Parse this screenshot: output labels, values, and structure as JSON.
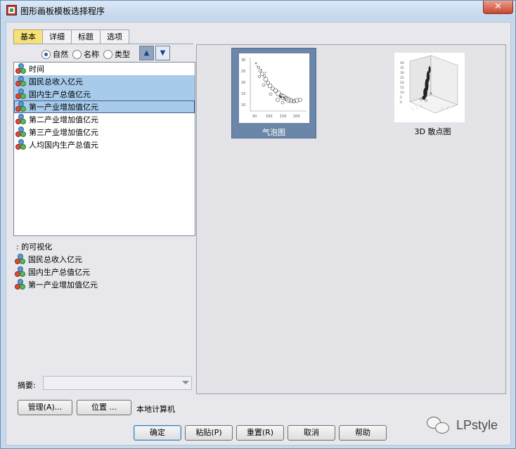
{
  "window": {
    "title": "图形画板模板选择程序",
    "close_label": "✕"
  },
  "tabs": [
    {
      "label": "基本",
      "active": true
    },
    {
      "label": "详细",
      "active": false
    },
    {
      "label": "标题",
      "active": false
    },
    {
      "label": "选项",
      "active": false
    }
  ],
  "sort": {
    "options": [
      {
        "label": "自然",
        "checked": true
      },
      {
        "label": "名称",
        "checked": false
      },
      {
        "label": "类型",
        "checked": false
      }
    ],
    "up_label": "▲",
    "down_label": "▼"
  },
  "variables": [
    {
      "label": "时间",
      "state": "normal"
    },
    {
      "label": "国民总收入亿元",
      "state": "selected"
    },
    {
      "label": "国内生产总值亿元",
      "state": "selected"
    },
    {
      "label": "第一产业增加值亿元",
      "state": "focused"
    },
    {
      "label": "第二产业增加值亿元",
      "state": "normal"
    },
    {
      "label": "第三产业增加值亿元",
      "state": "normal"
    },
    {
      "label": "人均国内生产总值元",
      "state": "normal"
    }
  ],
  "visualization": {
    "title": ": 的可视化",
    "items": [
      "国民总收入亿元",
      "国内生产总值亿元",
      "第一产业增加值亿元"
    ]
  },
  "summary": {
    "label": "摘要:",
    "value": ""
  },
  "buttons": {
    "manage": "管理(A)...",
    "location": "位置 ...",
    "location_text": "本地计算机",
    "ok": "确定",
    "paste": "粘贴(P)",
    "reset": "重置(R)",
    "cancel": "取消",
    "help": "帮助"
  },
  "gallery": [
    {
      "label": "气泡图",
      "selected": true,
      "icon": "bubble-chart-thumbnail"
    },
    {
      "label": "3D 散点图",
      "selected": false,
      "icon": "3d-scatter-thumbnail"
    }
  ],
  "thumbnail_axes": {
    "bubble_y_ticks": [
      "30",
      "25",
      "20",
      "15",
      "10"
    ],
    "bubble_x_ticks": [
      "50",
      "100",
      "150",
      "200"
    ],
    "scatter3d_y_ticks": [
      "40",
      "35",
      "30",
      "25",
      "20",
      "15",
      "10",
      "5",
      "0"
    ]
  },
  "watermark": {
    "text": "LPstyle"
  },
  "colors": {
    "tab_active": "#f7e27a",
    "list_selection": "#a8cbec",
    "gallery_selection": "#6a86a8",
    "close_button": "#c9452c"
  }
}
